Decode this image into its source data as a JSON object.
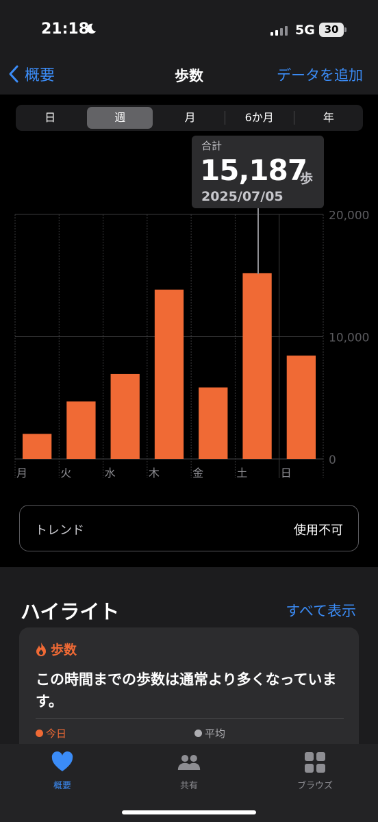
{
  "status_bar": {
    "time": "21:18",
    "network": "5G",
    "battery": "30"
  },
  "nav": {
    "back_label": "概要",
    "title": "歩数",
    "action_label": "データを追加"
  },
  "segments": [
    {
      "label": "日",
      "active": false
    },
    {
      "label": "週",
      "active": true
    },
    {
      "label": "月",
      "active": false
    },
    {
      "label": "6か月",
      "active": false
    },
    {
      "label": "年",
      "active": false
    }
  ],
  "tooltip": {
    "label": "合計",
    "value": "15,187",
    "unit": "歩",
    "date": "2025/07/05"
  },
  "chart_data": {
    "type": "bar",
    "categories": [
      "月",
      "火",
      "水",
      "木",
      "金",
      "土",
      "日"
    ],
    "values": [
      2050,
      4700,
      6950,
      13850,
      5850,
      15187,
      8450
    ],
    "ylim": [
      0,
      20000
    ],
    "yticks": [
      0,
      10000,
      20000
    ],
    "ytick_labels": [
      "0",
      "10,000",
      "20,000"
    ],
    "selected_index": 5,
    "bar_color": "#f06a35",
    "grid": true
  },
  "trend": {
    "label": "トレンド",
    "value": "使用不可"
  },
  "highlights": {
    "heading": "ハイライト",
    "show_all": "すべて表示",
    "card": {
      "category": "歩数",
      "message": "この時間までの歩数は通常より多くなっています。",
      "legend_today": "今日",
      "legend_average": "平均"
    }
  },
  "tabbar": [
    {
      "label": "概要",
      "icon": "heart-icon",
      "active": true
    },
    {
      "label": "共有",
      "icon": "people-icon",
      "active": false
    },
    {
      "label": "ブラウズ",
      "icon": "grid-icon",
      "active": false
    }
  ],
  "colors": {
    "accent": "#3b8cf7",
    "steps": "#f06a35"
  }
}
